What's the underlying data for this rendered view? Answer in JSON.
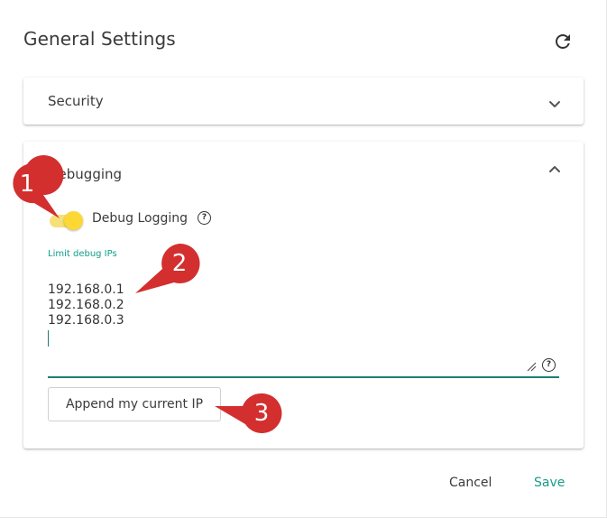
{
  "dialog": {
    "title": "General Settings",
    "refresh_icon": "refresh-icon"
  },
  "security_panel": {
    "label": "Security",
    "expanded": false,
    "chevron_icon": "chevron-down-icon"
  },
  "debugging_panel": {
    "label": "Debugging",
    "expanded": true,
    "chevron_icon": "chevron-up-icon",
    "debug_logging": {
      "label": "Debug Logging",
      "enabled": true,
      "help_icon": "help-icon"
    },
    "limit_ips": {
      "label": "Limit debug IPs",
      "value": "192.168.0.1\n192.168.0.2\n192.168.0.3\n",
      "help_icon": "help-icon"
    },
    "append_button": "Append my current IP"
  },
  "footer": {
    "cancel_label": "Cancel",
    "save_label": "Save"
  },
  "callouts": {
    "one": "1",
    "two": "2",
    "three": "3"
  },
  "colors": {
    "accent": "#1a9c88",
    "toggle_on": "#fdd835",
    "callout": "#d32f2f"
  }
}
